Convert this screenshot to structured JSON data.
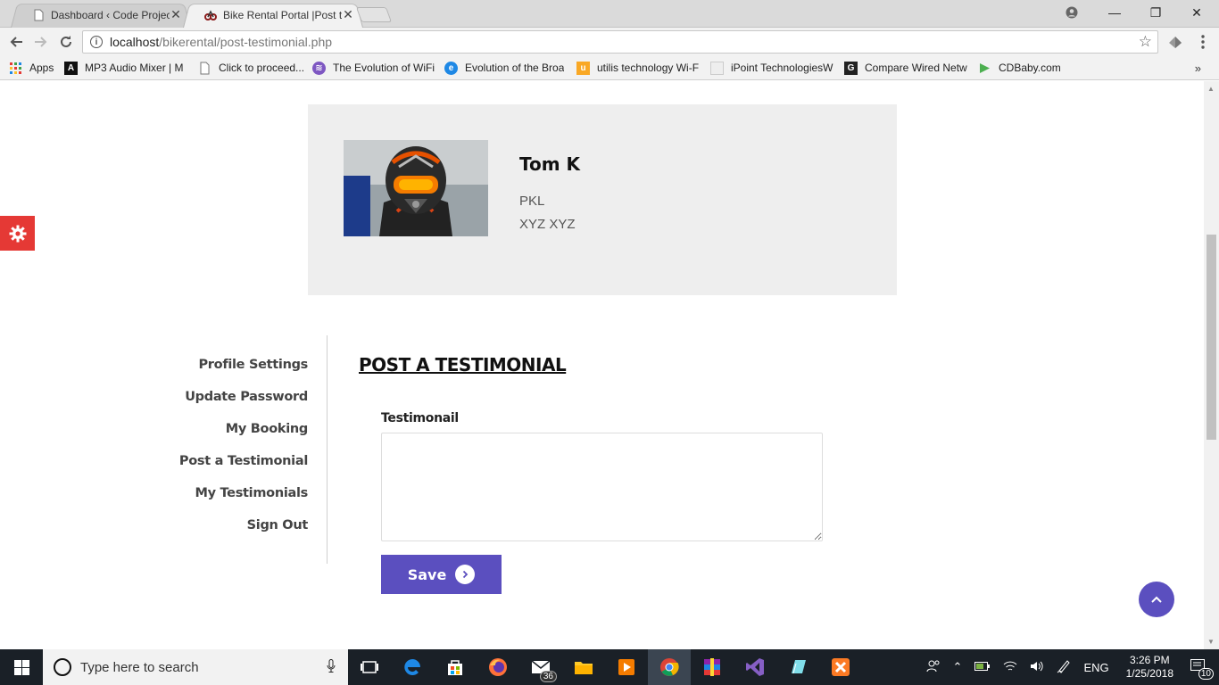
{
  "browser": {
    "tabs": [
      {
        "title": "Dashboard ‹ Code Projec",
        "close": "✕"
      },
      {
        "title": "Bike Rental Portal |Post te",
        "close": "✕"
      }
    ],
    "window_controls": {
      "minimize": "—",
      "restore": "❐",
      "close": "✕"
    },
    "url_host": "localhost",
    "url_path": "/bikerental/post-testimonial.php",
    "bookmarks": [
      {
        "label": "Apps",
        "icon": "apps-grid-icon",
        "color": "#e53935"
      },
      {
        "label": "MP3 Audio Mixer | M",
        "icon": "audio-mixer-icon",
        "color": "#111111"
      },
      {
        "label": "Click to proceed...",
        "icon": "page-icon",
        "color": "#999999"
      },
      {
        "label": "The Evolution of WiFi",
        "icon": "wifi-icon",
        "color": "#7e57c2"
      },
      {
        "label": "Evolution of the Broa",
        "icon": "broadband-icon",
        "color": "#1e88e5"
      },
      {
        "label": "utilis technology Wi-F",
        "icon": "utilis-icon",
        "color": "#f9a825"
      },
      {
        "label": "iPoint TechnologiesW",
        "icon": "blank-page-icon",
        "color": "#dddddd"
      },
      {
        "label": "Compare Wired Netw",
        "icon": "g-icon",
        "color": "#222222"
      },
      {
        "label": "CDBaby.com",
        "icon": "cdbaby-icon",
        "color": "#4caf50"
      }
    ],
    "bookmarks_more": "»"
  },
  "profile": {
    "name": "Tom K",
    "line1": "PKL",
    "line2": "XYZ XYZ"
  },
  "sidebar": {
    "items": [
      {
        "label": "Profile Settings"
      },
      {
        "label": "Update Password"
      },
      {
        "label": "My Booking"
      },
      {
        "label": "Post a Testimonial"
      },
      {
        "label": "My Testimonials"
      },
      {
        "label": "Sign Out"
      }
    ]
  },
  "form": {
    "title": "POST A TESTIMONIAL",
    "label": "Testimonail",
    "value": "",
    "save_label": "Save"
  },
  "taskbar": {
    "search_placeholder": "Type here to search",
    "mail_badge": "36",
    "lang": "ENG",
    "time": "3:26 PM",
    "date": "1/25/2018",
    "notifications": "10"
  },
  "colors": {
    "accent": "#5b4fbf",
    "gear_tab": "#e53935",
    "profile_bg": "#eeeeee"
  }
}
